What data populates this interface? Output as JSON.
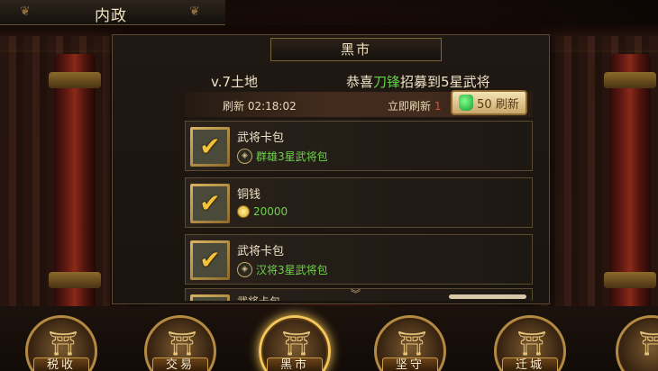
{
  "topbar": {
    "title": "内政"
  },
  "market": {
    "title": "黑市",
    "land": "v.7土地",
    "news": {
      "prefix": "恭喜",
      "name": "刀锋",
      "suffix": "招募到5星武将"
    },
    "refresh_label": "刷新 02:18:02",
    "immediate_label": "立即刷新",
    "immediate_count": "1",
    "refresh_button_label": "50 刷新"
  },
  "items": [
    {
      "name": "武将卡包",
      "desc": "群雄3星武将包",
      "icon": "badge-icon"
    },
    {
      "name": "铜钱",
      "desc": "20000",
      "icon": "coin-icon"
    },
    {
      "name": "武将卡包",
      "desc": "汉将3星武将包",
      "icon": "badge-icon"
    },
    {
      "name": "武将卡包"
    }
  ],
  "nav": [
    {
      "label": "税收",
      "active": false
    },
    {
      "label": "交易",
      "active": false
    },
    {
      "label": "黑市",
      "active": true
    },
    {
      "label": "坚守",
      "active": false
    },
    {
      "label": "迁城",
      "active": false
    },
    {
      "label": "",
      "active": false
    }
  ],
  "colors": {
    "accent_green": "#6ed44c",
    "gold": "#f2c65a",
    "alert_red": "#e04a3a"
  }
}
